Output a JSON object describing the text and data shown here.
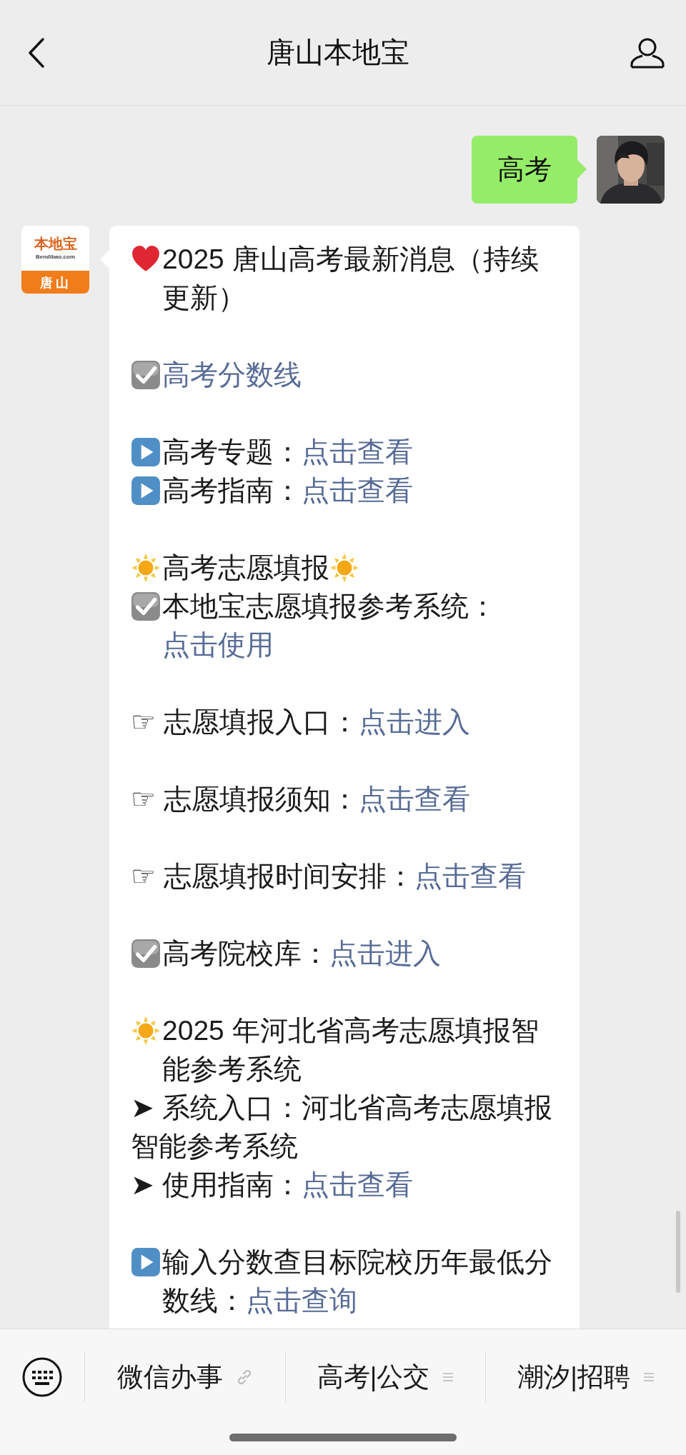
{
  "header": {
    "title": "唐山本地宝"
  },
  "user_message": {
    "text": "高考"
  },
  "article": {
    "logo": {
      "brand": "本地宝",
      "site": "Bendibao.com",
      "city": "唐山"
    },
    "groups": [
      [
        {
          "kind": "heart",
          "text": "2025 唐山高考最新消息（持续更新）"
        }
      ],
      [
        {
          "kind": "check",
          "link": "高考分数线"
        }
      ],
      [
        {
          "kind": "play",
          "text": "高考专题：",
          "link": "点击查看"
        },
        {
          "kind": "play",
          "text": "高考指南：",
          "link": "点击查看"
        }
      ],
      [
        {
          "kind": "sun_pair",
          "text": "高考志愿填报"
        },
        {
          "kind": "check",
          "text": "本地宝志愿填报参考系统：",
          "link": "点击使用"
        }
      ],
      [
        {
          "kind": "plain",
          "text": "☞ 志愿填报入口：",
          "link": "点击进入"
        }
      ],
      [
        {
          "kind": "plain",
          "text": "☞ 志愿填报须知：",
          "link": "点击查看"
        }
      ],
      [
        {
          "kind": "plain",
          "text": "☞ 志愿填报时间安排：",
          "link": "点击查看"
        }
      ],
      [
        {
          "kind": "check",
          "text": "高考院校库：",
          "link": "点击进入"
        }
      ],
      [
        {
          "kind": "sun",
          "text": "2025 年河北省高考志愿填报智能参考系统"
        },
        {
          "kind": "plain",
          "text": "➤ 系统入口：河北省高考志愿填报智能参考系统"
        },
        {
          "kind": "plain",
          "text": "➤ 使用指南：",
          "link": "点击查看"
        }
      ],
      [
        {
          "kind": "play",
          "text": "输入分数查目标院校历年最低分数线：",
          "link": "点击查询"
        }
      ]
    ]
  },
  "menu": [
    {
      "label": "微信办事",
      "kind": "link"
    },
    {
      "label": "高考|公交",
      "kind": "submenu"
    },
    {
      "label": "潮汐|招聘",
      "kind": "submenu"
    }
  ]
}
